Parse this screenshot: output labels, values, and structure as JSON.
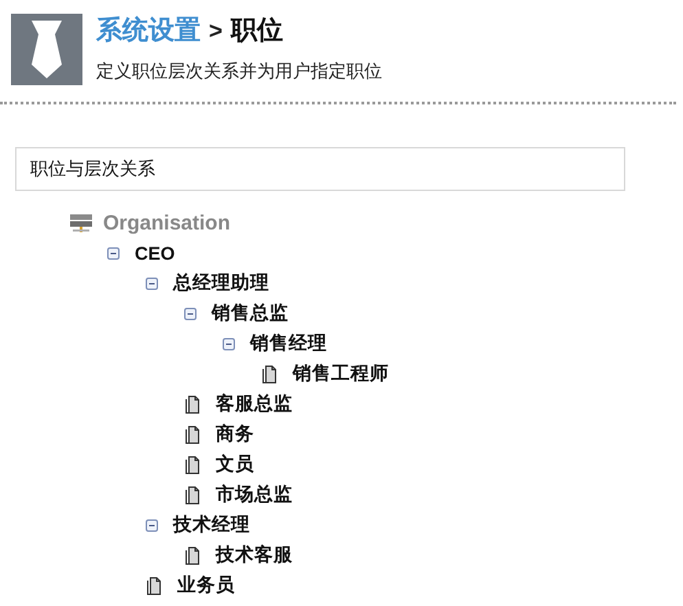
{
  "header": {
    "breadcrumb_link": "系统设置",
    "separator": ">",
    "title": "职位",
    "subtitle": "定义职位层次关系并为用户指定职位"
  },
  "panel": {
    "title": "职位与层次关系"
  },
  "tree": [
    {
      "label": "Organisation",
      "kind": "root",
      "children": [
        {
          "label": "CEO",
          "kind": "node",
          "expanded": true,
          "children": [
            {
              "label": "总经理助理",
              "kind": "node",
              "expanded": true,
              "children": [
                {
                  "label": "销售总监",
                  "kind": "node",
                  "expanded": true,
                  "children": [
                    {
                      "label": "销售经理",
                      "kind": "node",
                      "expanded": true,
                      "children": [
                        {
                          "label": "销售工程师",
                          "kind": "leaf"
                        }
                      ]
                    }
                  ]
                },
                {
                  "label": "客服总监",
                  "kind": "leaf"
                },
                {
                  "label": "商务",
                  "kind": "leaf"
                },
                {
                  "label": "文员",
                  "kind": "leaf"
                },
                {
                  "label": "市场总监",
                  "kind": "leaf"
                }
              ]
            },
            {
              "label": "技术经理",
              "kind": "node",
              "expanded": true,
              "children": [
                {
                  "label": "技术客服",
                  "kind": "leaf"
                }
              ]
            },
            {
              "label": "业务员",
              "kind": "leaf"
            }
          ]
        }
      ]
    }
  ]
}
